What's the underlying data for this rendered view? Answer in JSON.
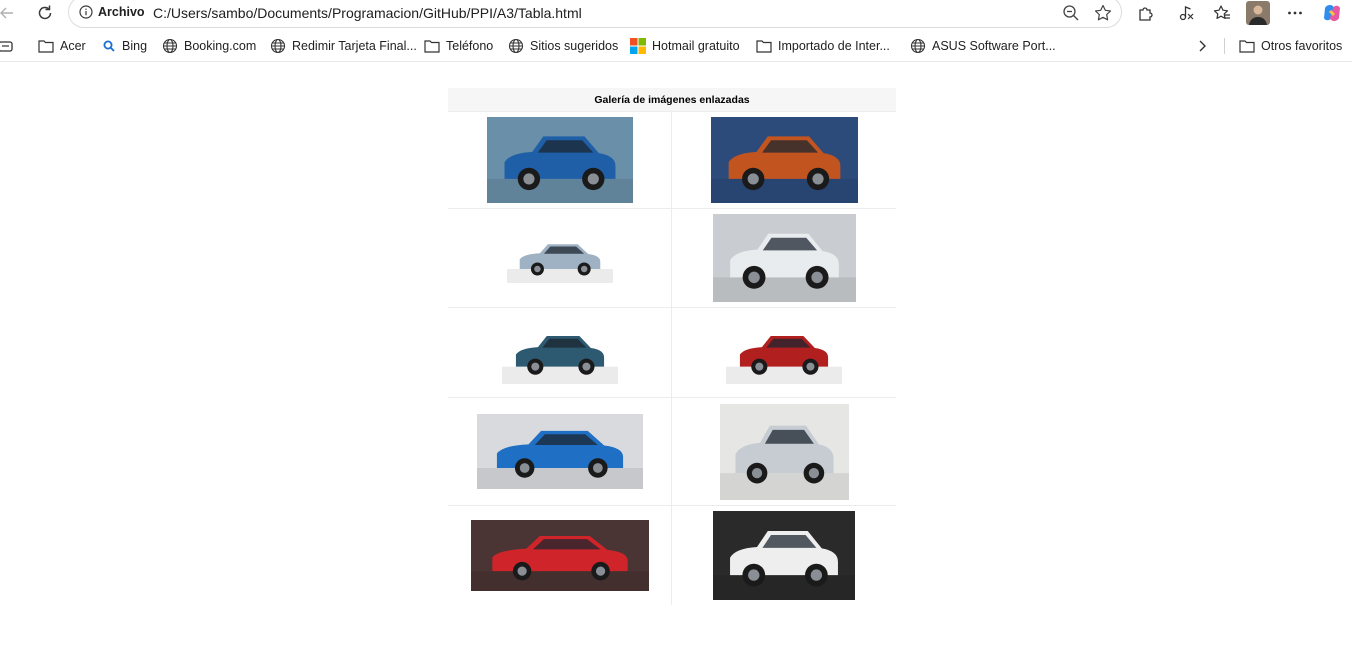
{
  "address_bar": {
    "label": "Archivo",
    "url": "C:/Users/sambo/Documents/Programacion/GitHub/PPI/A3/Tabla.html"
  },
  "favorites": [
    {
      "label": "Acer",
      "icon": "folder-icon"
    },
    {
      "label": "Bing",
      "icon": "search-icon"
    },
    {
      "label": "Booking.com",
      "icon": "globe-icon"
    },
    {
      "label": "Redimir Tarjeta Final...",
      "icon": "globe-icon"
    },
    {
      "label": "Teléfono",
      "icon": "folder-icon"
    },
    {
      "label": "Sitios sugeridos",
      "icon": "globe-icon"
    },
    {
      "label": "Hotmail gratuito",
      "icon": "microsoft-icon"
    },
    {
      "label": "Importado de Inter...",
      "icon": "folder-icon"
    },
    {
      "label": "ASUS Software Port...",
      "icon": "globe-icon"
    }
  ],
  "other_favorites": "Otros favoritos",
  "gallery": {
    "title": "Galería de imágenes enlazadas",
    "images": [
      {
        "name": "car-blue-sedan-image",
        "colors": {
          "bg": "#6a8fa8",
          "body": "#1f5fa8"
        }
      },
      {
        "name": "car-orange-suv-image",
        "colors": {
          "bg": "#2c4a7a",
          "body": "#c2541f"
        }
      },
      {
        "name": "car-silver-sedan-image",
        "colors": {
          "bg": "#ffffff",
          "body": "#9fb2c4"
        }
      },
      {
        "name": "car-white-suv-image",
        "colors": {
          "bg": "#c9ccd0",
          "body": "#e9ecef"
        }
      },
      {
        "name": "car-teal-suv-image",
        "colors": {
          "bg": "#ffffff",
          "body": "#2d5a70"
        }
      },
      {
        "name": "car-red-suv-image",
        "colors": {
          "bg": "#ffffff",
          "body": "#b21f1f"
        }
      },
      {
        "name": "car-blue-pickup-image",
        "colors": {
          "bg": "#d8dadd",
          "body": "#1f6fc4"
        }
      },
      {
        "name": "car-silver-suv-showroom-image",
        "colors": {
          "bg": "#e6e6e4",
          "body": "#c7ccd2"
        }
      },
      {
        "name": "car-red-crossover-image",
        "colors": {
          "bg": "#4a3434",
          "body": "#d0242b"
        }
      },
      {
        "name": "car-white-compact-suv-image",
        "colors": {
          "bg": "#2a2a2a",
          "body": "#eeeeee"
        }
      }
    ]
  }
}
